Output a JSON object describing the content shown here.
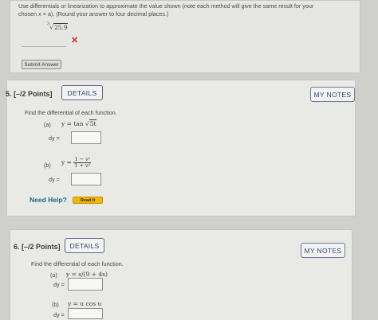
{
  "prev": {
    "instruction_line1": "Use differentials or linearization to approximate the value shown (note each method will give the same result for your",
    "instruction_line2": "chosen  x = a).  (Round your answer to four decimal places.)",
    "radical_index": "3",
    "radicand": "25.9",
    "result_mark": "✕",
    "submit_label": "Submit Answer"
  },
  "q5": {
    "title": "5.  [–/2 Points]",
    "details_label": "DETAILS",
    "notes_label": "MY NOTES",
    "prompt": "Find the differential of each function.",
    "part_a_label": "(a)",
    "part_a_lhs": "y = tan",
    "part_a_radicand": "5t",
    "dy_label": "dy =",
    "part_b_label": "(b)",
    "part_b_lhs": "y =",
    "part_b_num": "1 − v²",
    "part_b_den": "1 + v²",
    "help_label": "Need Help?",
    "readit_label": "Read It"
  },
  "q6": {
    "title": "6.  [–/2 Points]",
    "details_label": "DETAILS",
    "notes_label": "MY NOTES",
    "prompt": "Find the differential of each function.",
    "part_a_label": "(a)",
    "part_a_expr": "y = s/(9 + 4s)",
    "dy_label": "dy =",
    "part_b_label": "(b)",
    "part_b_expr": "y = u cos u"
  }
}
